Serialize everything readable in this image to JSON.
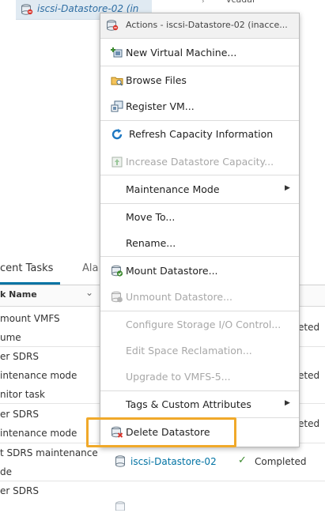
{
  "tree": {
    "datastore_label": "iscsi-Datastore-02 (in"
  },
  "top_fragment": {
    "text": "vcadar"
  },
  "tasks": {
    "tab_active": "cent Tasks",
    "tab_inactive": "Ala",
    "col_task_name": "k Name",
    "rows": [
      {
        "lines": [
          "mount VMFS",
          "ume"
        ]
      },
      {
        "lines": [
          "er SDRS",
          "intenance mode",
          "nitor task"
        ]
      },
      {
        "lines": [
          "er SDRS",
          "intenance mode"
        ]
      },
      {
        "lines": [
          "t SDRS maintenance",
          "de"
        ]
      },
      {
        "lines": [
          "er SDRS"
        ]
      }
    ],
    "status_fragments": [
      "eted",
      "eted",
      "eted"
    ],
    "visible_row": {
      "target": "iscsi-Datastore-02",
      "status": "Completed"
    }
  },
  "menu": {
    "header": "Actions - iscsi-Datastore-02 (inacce...",
    "items": {
      "new_vm": "New Virtual Machine...",
      "browse_files": "Browse Files",
      "register_vm": "Register VM...",
      "refresh_capacity": "Refresh Capacity Information",
      "increase_capacity": "Increase Datastore Capacity...",
      "maintenance_mode": "Maintenance Mode",
      "move_to": "Move To...",
      "rename": "Rename...",
      "mount_datastore": "Mount Datastore...",
      "unmount_datastore": "Unmount Datastore...",
      "configure_sioc": "Configure Storage I/O Control...",
      "edit_space": "Edit Space Reclamation...",
      "upgrade_vmfs": "Upgrade to VMFS-5...",
      "tags": "Tags & Custom Attributes",
      "delete_datastore": "Delete Datastore"
    }
  },
  "icons": {
    "datastore": "datastore-error-icon",
    "new_vm": "new-vm-icon",
    "browse": "folder-icon",
    "register": "register-vm-icon",
    "refresh": "refresh-icon",
    "increase": "increase-capacity-icon",
    "mount": "mount-icon",
    "unmount": "unmount-icon",
    "delete": "delete-datastore-icon"
  },
  "colors": {
    "highlight": "#f0a92a",
    "link": "#0072a3",
    "success": "#3c8a2e"
  }
}
